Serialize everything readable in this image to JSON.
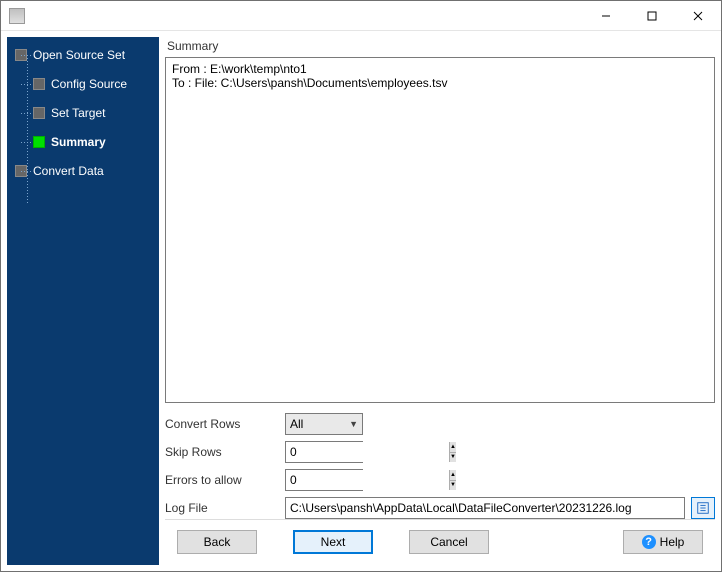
{
  "titlebar": {
    "title": ""
  },
  "sidebar": {
    "items": [
      {
        "label": "Open Source Set",
        "current": false,
        "level": 0
      },
      {
        "label": "Config Source",
        "current": false,
        "level": 1
      },
      {
        "label": "Set Target",
        "current": false,
        "level": 1
      },
      {
        "label": "Summary",
        "current": true,
        "level": 1
      },
      {
        "label": "Convert Data",
        "current": false,
        "level": 0
      }
    ]
  },
  "main": {
    "panel_title": "Summary",
    "summary_text": "From : E:\\work\\temp\\nto1\nTo : File: C:\\Users\\pansh\\Documents\\employees.tsv",
    "form": {
      "convert_rows_label": "Convert Rows",
      "convert_rows_value": "All",
      "skip_rows_label": "Skip Rows",
      "skip_rows_value": "0",
      "errors_label": "Errors to allow",
      "errors_value": "0",
      "log_file_label": "Log File",
      "log_file_value": "C:\\Users\\pansh\\AppData\\Local\\DataFileConverter\\20231226.log"
    }
  },
  "footer": {
    "back": "Back",
    "next": "Next",
    "cancel": "Cancel",
    "help": "Help"
  }
}
